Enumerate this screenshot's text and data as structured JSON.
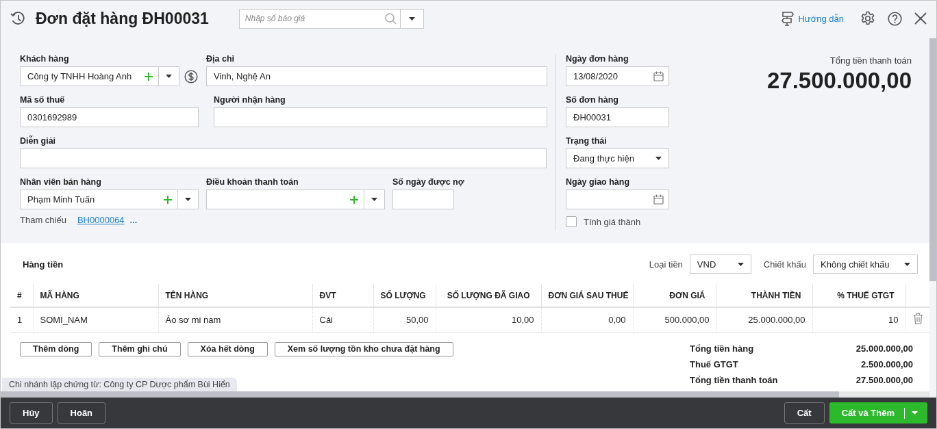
{
  "header": {
    "title": "Đơn đặt hàng ĐH00031",
    "search": {
      "placeholder": "Nhập số báo giá"
    },
    "guide": "Hướng dẫn"
  },
  "customer": {
    "label": "Khách hàng",
    "value": "Công ty TNHH Hoàng Anh",
    "kind": "combo"
  },
  "address": {
    "label": "Địa chỉ",
    "value": "Vinh, Nghệ An",
    "kind": "text"
  },
  "tax_code": {
    "label": "Mã số thuế",
    "value": "0301692989",
    "kind": "text"
  },
  "receiver": {
    "label": "Người nhận hàng",
    "kind": "text"
  },
  "description": {
    "label": "Diễn giải",
    "kind": "text"
  },
  "salesperson": {
    "label": "Nhân viên bán hàng",
    "value": "Phạm Minh Tuấn",
    "kind": "combo"
  },
  "payment_terms": {
    "label": "Điều khoản thanh toán",
    "kind": "combo"
  },
  "credit_days": {
    "label": "Số ngày được nợ",
    "kind": "text"
  },
  "reference": {
    "label": "Tham chiếu",
    "link": "BH0000064",
    "more": "..."
  },
  "order_date": {
    "label": "Ngày đơn hàng",
    "value": "13/08/2020",
    "kind": "date"
  },
  "order_number": {
    "label": "Số đơn hàng",
    "value": "ĐH00031",
    "kind": "text"
  },
  "status": {
    "label": "Trạng thái",
    "value": "Đang thực hiện",
    "kind": "select"
  },
  "delivery_date": {
    "label": "Ngày giao hàng",
    "kind": "date"
  },
  "costing": {
    "label": "Tính giá thành",
    "checked": false
  },
  "total": {
    "label": "Tổng tiền thanh toán",
    "value": "27.500.000,00"
  },
  "items": {
    "title": "Hàng tiền",
    "currency": {
      "label": "Loại tiền",
      "value": "VND"
    },
    "discount": {
      "label": "Chiết khấu",
      "value": "Không chiết khấu"
    },
    "table": {
      "columns": [
        {
          "label": "#",
          "kind": "text"
        },
        {
          "label": "MÃ HÀNG",
          "kind": "text"
        },
        {
          "label": "TÊN HÀNG",
          "kind": "text"
        },
        {
          "label": "ĐVT",
          "kind": "text"
        },
        {
          "label": "SỐ LƯỢNG",
          "kind": "number"
        },
        {
          "label": "SỐ LƯỢNG ĐÃ GIAO",
          "kind": "number"
        },
        {
          "label": "ĐƠN GIÁ SAU THUẾ",
          "kind": "number"
        },
        {
          "label": "ĐƠN GIÁ",
          "kind": "number"
        },
        {
          "label": "THÀNH TIỀN",
          "kind": "number"
        },
        {
          "label": "% THUẾ GTGT",
          "kind": "number"
        }
      ],
      "rows": [
        [
          "1",
          "SOMI_NAM",
          "Áo sơ mi nam",
          "Cái",
          "50,00",
          "10,00",
          "0,00",
          "500.000,00",
          "25.000.000,00",
          "10"
        ]
      ]
    },
    "buttons": [
      "Thêm dòng",
      "Thêm ghi chú",
      "Xóa hết dòng",
      "Xem số lượng tồn kho chưa đặt hàng"
    ],
    "summary": [
      {
        "label": "Tổng tiền hàng",
        "value": "25.000.000,00"
      },
      {
        "label": "Thuế GTGT",
        "value": "2.500.000,00"
      },
      {
        "label": "Tổng tiền thanh toán",
        "value": "27.500.000,00"
      }
    ]
  },
  "branch": "Chi nhánh lập chứng từ: Công ty CP Dược phẩm Bùi Hiển",
  "footer": {
    "left": [
      "Hủy",
      "Hoãn"
    ],
    "save": "Cất",
    "save_add": "Cất và Thêm"
  }
}
